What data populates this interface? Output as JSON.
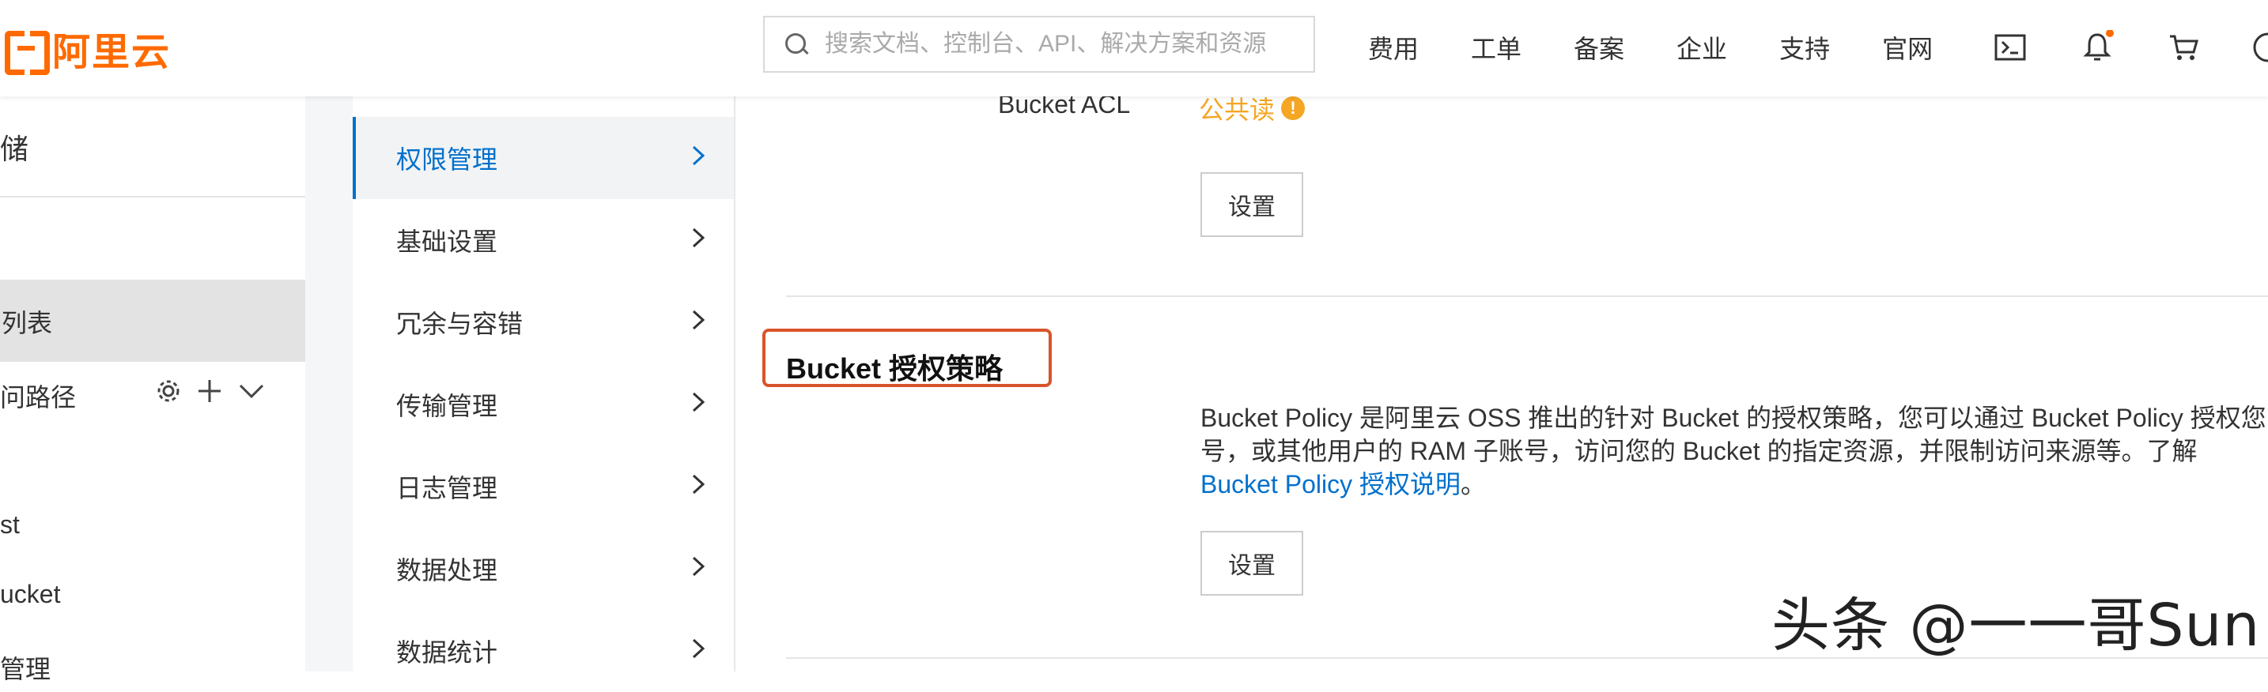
{
  "header": {
    "logo_text": "阿里云",
    "search_placeholder": "搜索文档、控制台、API、解决方案和资源",
    "nav": [
      "费用",
      "工单",
      "备案",
      "企业",
      "支持",
      "官网"
    ],
    "icons": [
      "terminal-icon",
      "bell-icon",
      "cart-icon",
      "help-icon"
    ],
    "notification_dot_color": "#ff6a00"
  },
  "sidebar": {
    "title_partial": "储",
    "items": [
      {
        "label": "列表",
        "active": true
      },
      {
        "label": "问路径"
      },
      {
        "label": "st"
      },
      {
        "label": "ucket"
      },
      {
        "label": "管理"
      }
    ]
  },
  "menu": {
    "items": [
      {
        "label": "权限管理",
        "active": true
      },
      {
        "label": "基础设置"
      },
      {
        "label": "冗余与容错"
      },
      {
        "label": "传输管理"
      },
      {
        "label": "日志管理"
      },
      {
        "label": "数据处理"
      },
      {
        "label": "数据统计"
      }
    ]
  },
  "main": {
    "acl_label": "Bucket ACL",
    "acl_value": "公共读",
    "acl_warn": "!",
    "acl_button": "设置",
    "policy_title": "Bucket 授权策略",
    "policy_desc_line1": "Bucket Policy 是阿里云 OSS 推出的针对 Bucket 的授权策略，您可以通过 Bucket Policy 授权您",
    "policy_desc_line2": "号，或其他用户的 RAM 子账号，访问您的 Bucket 的指定资源，并限制访问来源等。了解",
    "policy_link": "Bucket Policy 授权说明",
    "policy_period": "。",
    "policy_button": "设置"
  },
  "watermark": "头条 @一一哥Sun",
  "colors": {
    "brand": "#ff6a00",
    "link": "#0070cc",
    "warning": "#f5a623",
    "highlight_box": "#d9542a"
  }
}
